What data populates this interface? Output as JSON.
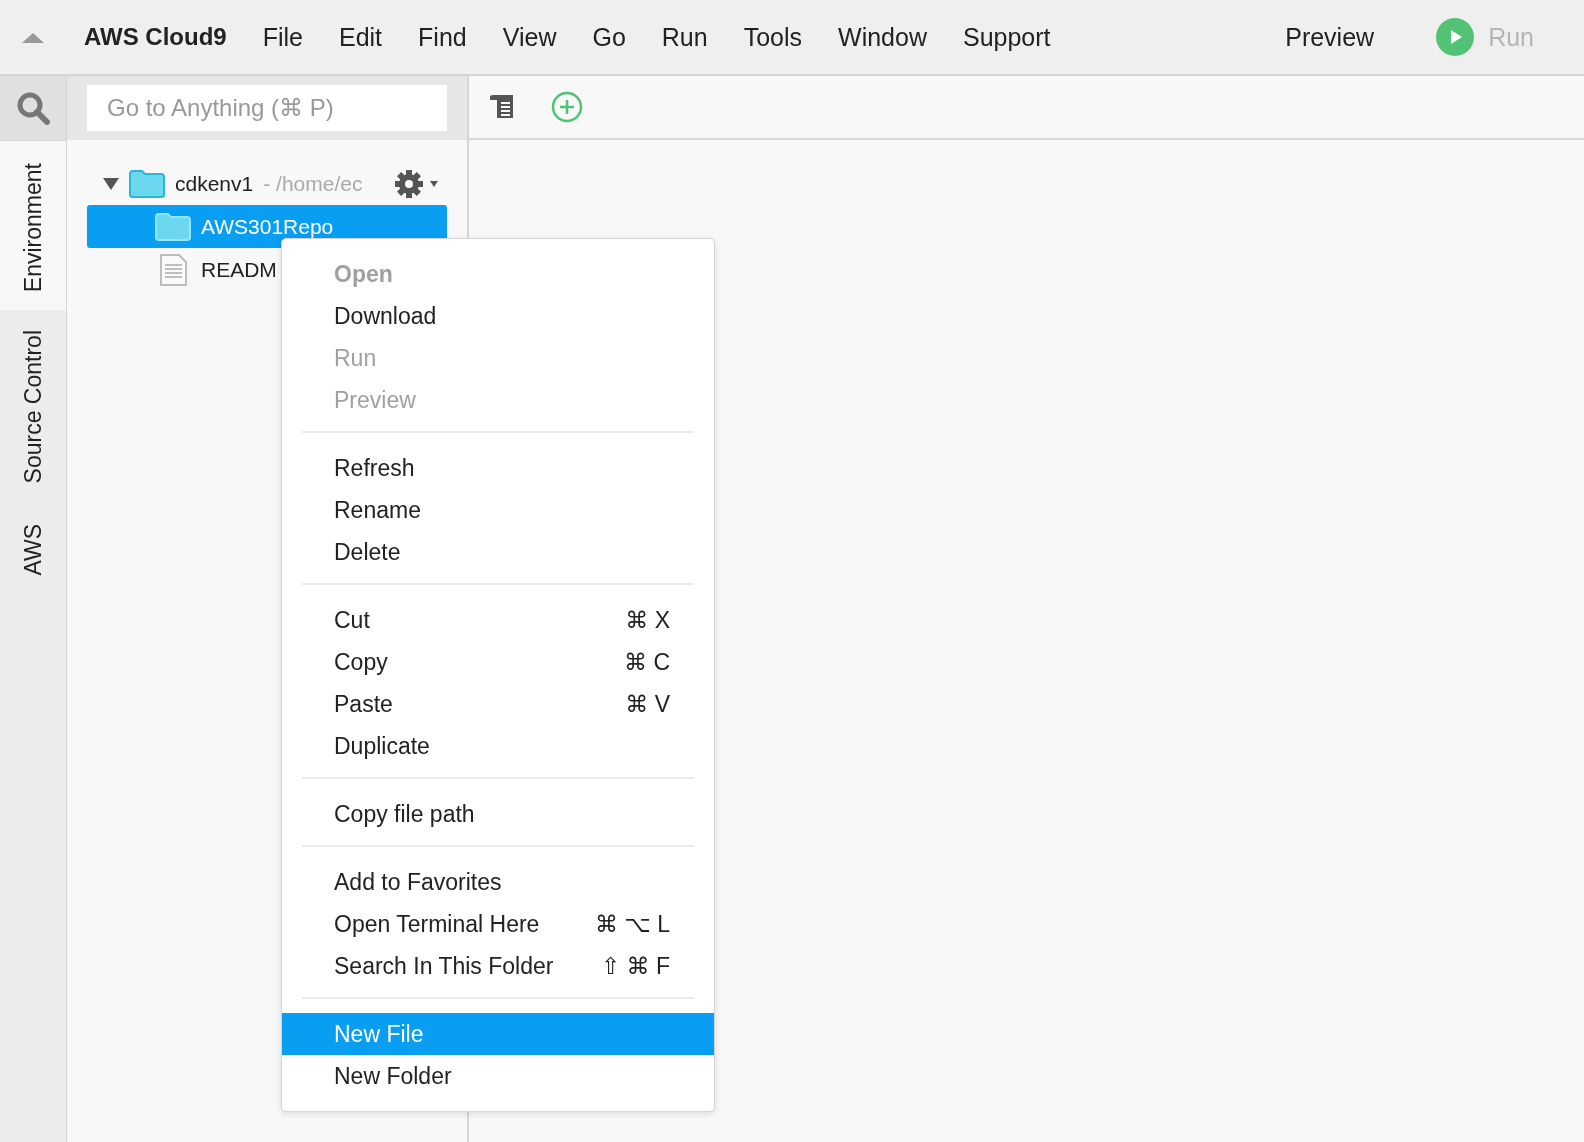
{
  "menu_bar": {
    "brand": "AWS Cloud9",
    "menus": [
      "File",
      "Edit",
      "Find",
      "View",
      "Go",
      "Run",
      "Tools",
      "Window",
      "Support"
    ],
    "preview": "Preview",
    "run": {
      "label": "Run",
      "disabled": true
    }
  },
  "side_tabs": [
    {
      "label": "Environment",
      "selected": true
    },
    {
      "label": "Source Control",
      "selected": false
    },
    {
      "label": "AWS",
      "selected": false
    }
  ],
  "search": {
    "placeholder": "Go to Anything (⌘ P)"
  },
  "tree": [
    {
      "kind": "folder",
      "name": "cdkenv1",
      "path": "- /home/ec",
      "expanded": true,
      "selected": false,
      "children": [
        {
          "kind": "folder",
          "name": "AWS301Repo",
          "selected": true
        },
        {
          "kind": "file",
          "name": "READM",
          "selected": false
        }
      ]
    }
  ],
  "context_menu": [
    [
      {
        "label": "Open",
        "default": true,
        "disabled": true,
        "selected": false
      },
      {
        "label": "Download",
        "disabled": false,
        "selected": false
      },
      {
        "label": "Run",
        "disabled": true,
        "selected": false
      },
      {
        "label": "Preview",
        "disabled": true,
        "selected": false
      }
    ],
    [
      {
        "label": "Refresh",
        "disabled": false,
        "selected": false
      },
      {
        "label": "Rename",
        "disabled": false,
        "selected": false
      },
      {
        "label": "Delete",
        "disabled": false,
        "selected": false
      }
    ],
    [
      {
        "label": "Cut",
        "shortcut": "⌘ X",
        "disabled": false,
        "selected": false
      },
      {
        "label": "Copy",
        "shortcut": "⌘ C",
        "disabled": false,
        "selected": false
      },
      {
        "label": "Paste",
        "shortcut": "⌘ V",
        "disabled": false,
        "selected": false
      },
      {
        "label": "Duplicate",
        "disabled": false,
        "selected": false
      }
    ],
    [
      {
        "label": "Copy file path",
        "disabled": false,
        "selected": false
      }
    ],
    [
      {
        "label": "Add to Favorites",
        "disabled": false,
        "selected": false
      },
      {
        "label": "Open Terminal Here",
        "shortcut": "⌘ ⌥ L",
        "disabled": false,
        "selected": false
      },
      {
        "label": "Search In This Folder",
        "shortcut": "⇧ ⌘ F",
        "disabled": false,
        "selected": false
      }
    ],
    [
      {
        "label": "New File",
        "disabled": false,
        "selected": true
      },
      {
        "label": "New Folder",
        "disabled": false,
        "selected": false
      }
    ]
  ]
}
